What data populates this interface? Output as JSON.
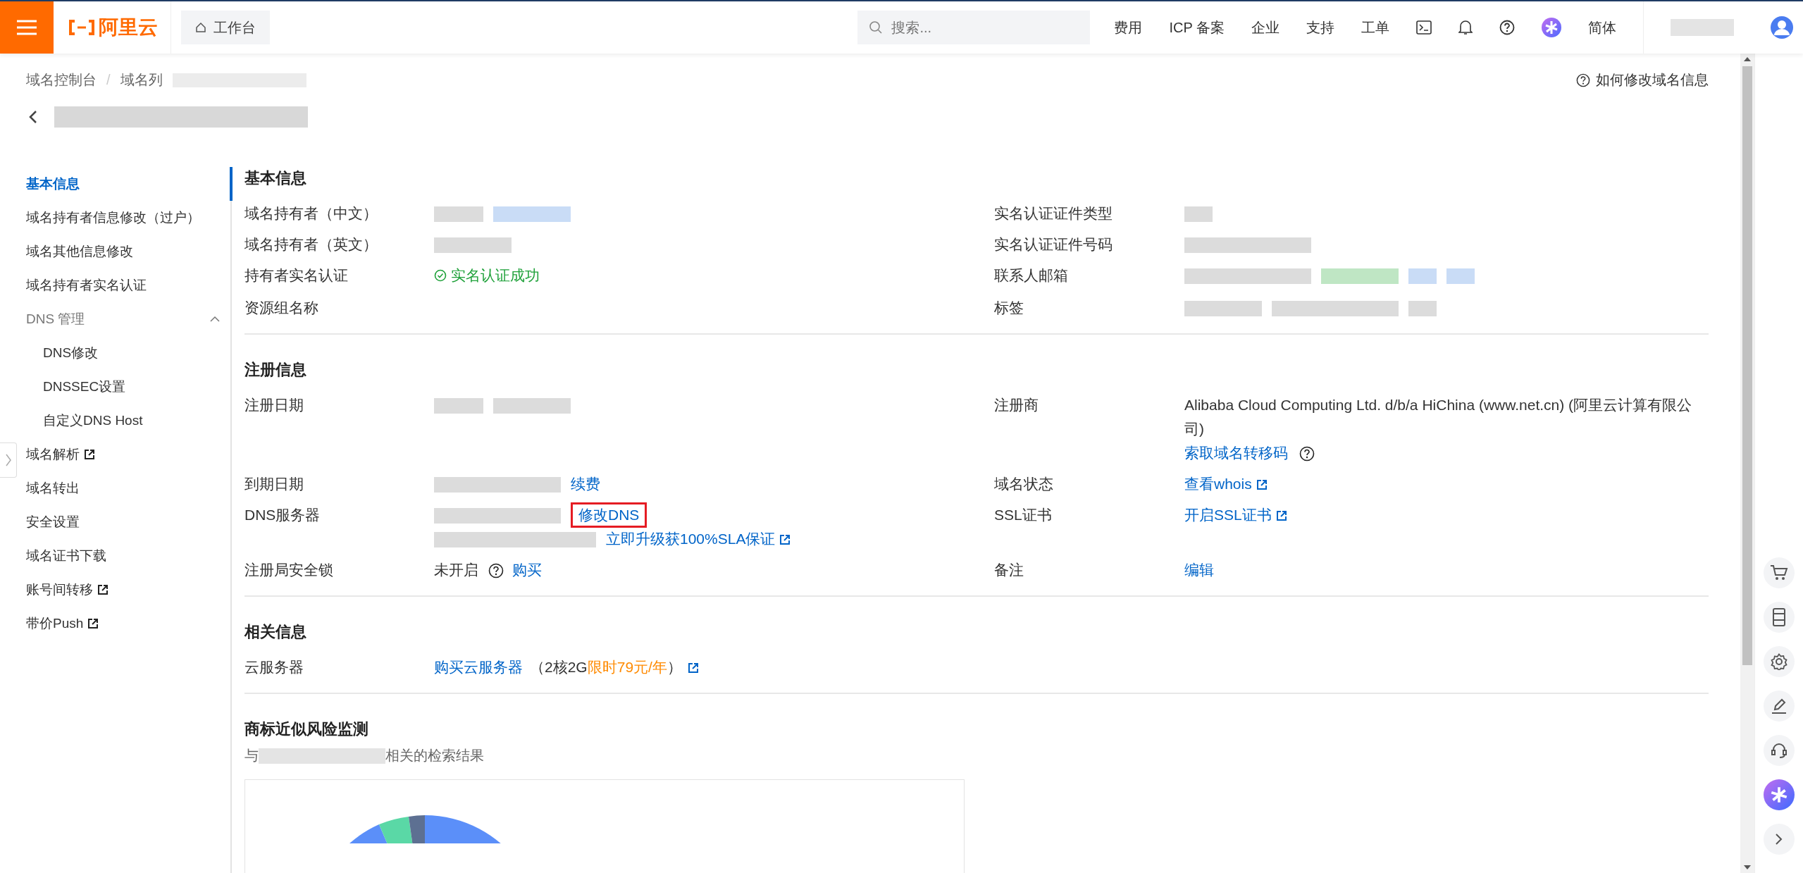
{
  "topbar": {
    "logo": "阿里云",
    "workbench_tab": "工作台",
    "search": {
      "placeholder": "搜索..."
    },
    "nav_links": [
      "费用",
      "ICP 备案",
      "企业",
      "支持",
      "工单"
    ],
    "language": "简体"
  },
  "breadcrumb": {
    "items": [
      "域名控制台",
      "域名列"
    ],
    "separator": "/",
    "redacted_tail": true
  },
  "help_link": "如何修改域名信息",
  "sidebar": {
    "items": [
      {
        "label": "基本信息",
        "selected": true,
        "external": false
      },
      {
        "label": "域名持有者信息修改（过户）",
        "selected": false,
        "external": false
      },
      {
        "label": "域名其他信息修改",
        "selected": false,
        "external": false
      },
      {
        "label": "域名持有者实名认证",
        "selected": false,
        "external": false
      },
      {
        "label": "DNS 管理",
        "selected": false,
        "external": false,
        "expanded": true,
        "children": [
          {
            "label": "DNS修改",
            "selected": false
          },
          {
            "label": "DNSSEC设置",
            "selected": false
          },
          {
            "label": "自定义DNS Host",
            "selected": false
          }
        ]
      },
      {
        "label": "域名解析",
        "selected": false,
        "external": true
      },
      {
        "label": "域名转出",
        "selected": false,
        "external": false
      },
      {
        "label": "安全设置",
        "selected": false,
        "external": false
      },
      {
        "label": "域名证书下载",
        "selected": false,
        "external": false
      },
      {
        "label": "账号间转移",
        "selected": false,
        "external": true
      },
      {
        "label": "带价Push",
        "selected": false,
        "external": true
      }
    ]
  },
  "sections": [
    {
      "kind": "info",
      "heading": "基本信息",
      "rows": [
        {
          "left": {
            "label": "域名持有者（中文）",
            "parts": [
              {
                "kind": "redacted-s",
                "color": "#dcdcdc"
              },
              {
                "kind": "redacted-m",
                "color": "#c9dcf6"
              }
            ]
          },
          "right": {
            "label": "实名认证证件类型",
            "parts": [
              {
                "kind": "redacted-xs",
                "color": "#dcdcdc"
              }
            ]
          }
        },
        {
          "left": {
            "label": "域名持有者（英文）",
            "parts": [
              {
                "kind": "redacted-m",
                "color": "#dcdcdc"
              }
            ]
          },
          "right": {
            "label": "实名认证证件号码",
            "parts": [
              {
                "kind": "redacted-l",
                "color": "#dcdcdc"
              }
            ]
          }
        },
        {
          "left": {
            "label": "持有者实名认证",
            "parts": [
              {
                "kind": "success",
                "text": "实名认证成功"
              }
            ]
          },
          "right": {
            "label": "联系人邮箱",
            "parts": [
              {
                "kind": "redacted-l",
                "color": "#dcdcdc"
              },
              {
                "kind": "redacted-m",
                "color": "#bfe6c4"
              },
              {
                "kind": "redacted-xs",
                "color": "#c9dcf6"
              },
              {
                "kind": "redacted-xs",
                "color": "#c9dcf6"
              }
            ]
          }
        },
        {
          "left": {
            "label": "资源组名称"
          },
          "right": {
            "label": "标签",
            "parts": [
              {
                "kind": "redacted-m",
                "color": "#dcdcdc"
              },
              {
                "kind": "redacted-l",
                "color": "#dcdcdc"
              },
              {
                "kind": "redacted-xs",
                "color": "#dcdcdc"
              }
            ]
          }
        }
      ]
    },
    {
      "kind": "info",
      "heading": "注册信息",
      "rows": [
        {
          "left": {
            "label": "注册日期",
            "parts": [
              {
                "kind": "redacted-s",
                "color": "#dcdcdc"
              },
              {
                "kind": "redacted-m",
                "color": "#dcdcdc"
              }
            ]
          },
          "right": {
            "label": "注册商",
            "parts": [
              {
                "kind": "text",
                "text": "Alibaba Cloud Computing Ltd. d/b/a HiChina (www.net.cn) (阿里云计算有限公司)"
              },
              {
                "kind": "link",
                "text": "索取域名转移码",
                "external": false,
                "boxed": false
              },
              {
                "kind": "help"
              }
            ]
          }
        },
        {
          "left": {
            "label": "到期日期",
            "parts": [
              {
                "kind": "redacted-l",
                "color": "#dcdcdc"
              },
              {
                "kind": "link",
                "text": "续费",
                "external": false,
                "boxed": false
              }
            ]
          },
          "right": {
            "label": "域名状态",
            "parts": [
              {
                "kind": "link",
                "text": "查看whois",
                "external": true,
                "boxed": false
              }
            ]
          }
        },
        {
          "left": {
            "label": "DNS服务器",
            "parts": [
              {
                "kind": "redacted-l",
                "color": "#dcdcdc"
              },
              {
                "kind": "link",
                "text": "修改DNS",
                "external": false,
                "boxed": true
              },
              {
                "kind": "break"
              },
              {
                "kind": "redacted-xl",
                "color": "#dcdcdc"
              },
              {
                "kind": "link",
                "text": "立即升级获100%SLA保证",
                "external": true,
                "boxed": false
              }
            ]
          },
          "right": {
            "label": "SSL证书",
            "parts": [
              {
                "kind": "link",
                "text": "开启SSL证书",
                "external": true,
                "boxed": false
              }
            ]
          }
        },
        {
          "left": {
            "label": "注册局安全锁",
            "parts": [
              {
                "kind": "text",
                "text": "未开启"
              },
              {
                "kind": "help"
              },
              {
                "kind": "link",
                "text": "购买",
                "external": false,
                "boxed": false
              }
            ]
          },
          "right": {
            "label": "备注",
            "parts": [
              {
                "kind": "link",
                "text": "编辑",
                "external": false,
                "boxed": false
              }
            ]
          }
        }
      ]
    },
    {
      "kind": "info",
      "heading": "相关信息",
      "rows": [
        {
          "left": {
            "label": "云服务器",
            "parts": [
              {
                "kind": "link",
                "text": "购买云服务器",
                "external": false,
                "boxed": false
              },
              {
                "kind": "text",
                "text": "（2核2G"
              },
              {
                "kind": "promo",
                "text": "限时79元/年"
              },
              {
                "kind": "text",
                "text": "）"
              },
              {
                "kind": "external-icon"
              }
            ]
          }
        }
      ]
    },
    {
      "kind": "monitor",
      "heading": "商标近似风险监测",
      "subtitle": [
        {
          "kind": "text",
          "text": "与"
        },
        {
          "kind": "redacted-l",
          "color": "#e4e4e4"
        },
        {
          "kind": "text",
          "text": "相关的检索结果"
        }
      ]
    }
  ]
}
